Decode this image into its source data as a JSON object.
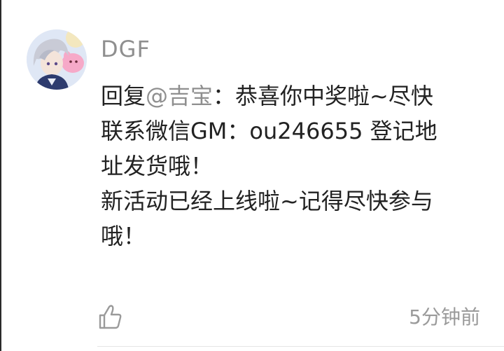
{
  "comment": {
    "username": "DGF",
    "reply_prefix": "回复",
    "mention": "@吉宝",
    "line1_rest": "：恭喜你中奖啦~尽快",
    "line2": "联系微信GM：ou246655 登记地",
    "line3": "址发货哦！",
    "line4": "新活动已经上线啦~记得尽快参与",
    "line5": "哦！",
    "timestamp": "5分钟前",
    "like_icon": "thumbs-up-outline-icon",
    "avatar": "anime-character-avatar"
  },
  "colors": {
    "username": "#8f8f8f",
    "mention": "#8f8f8f",
    "body_text": "#222222",
    "timestamp": "#9a9a9a",
    "left_border": "#2a2a2a"
  }
}
